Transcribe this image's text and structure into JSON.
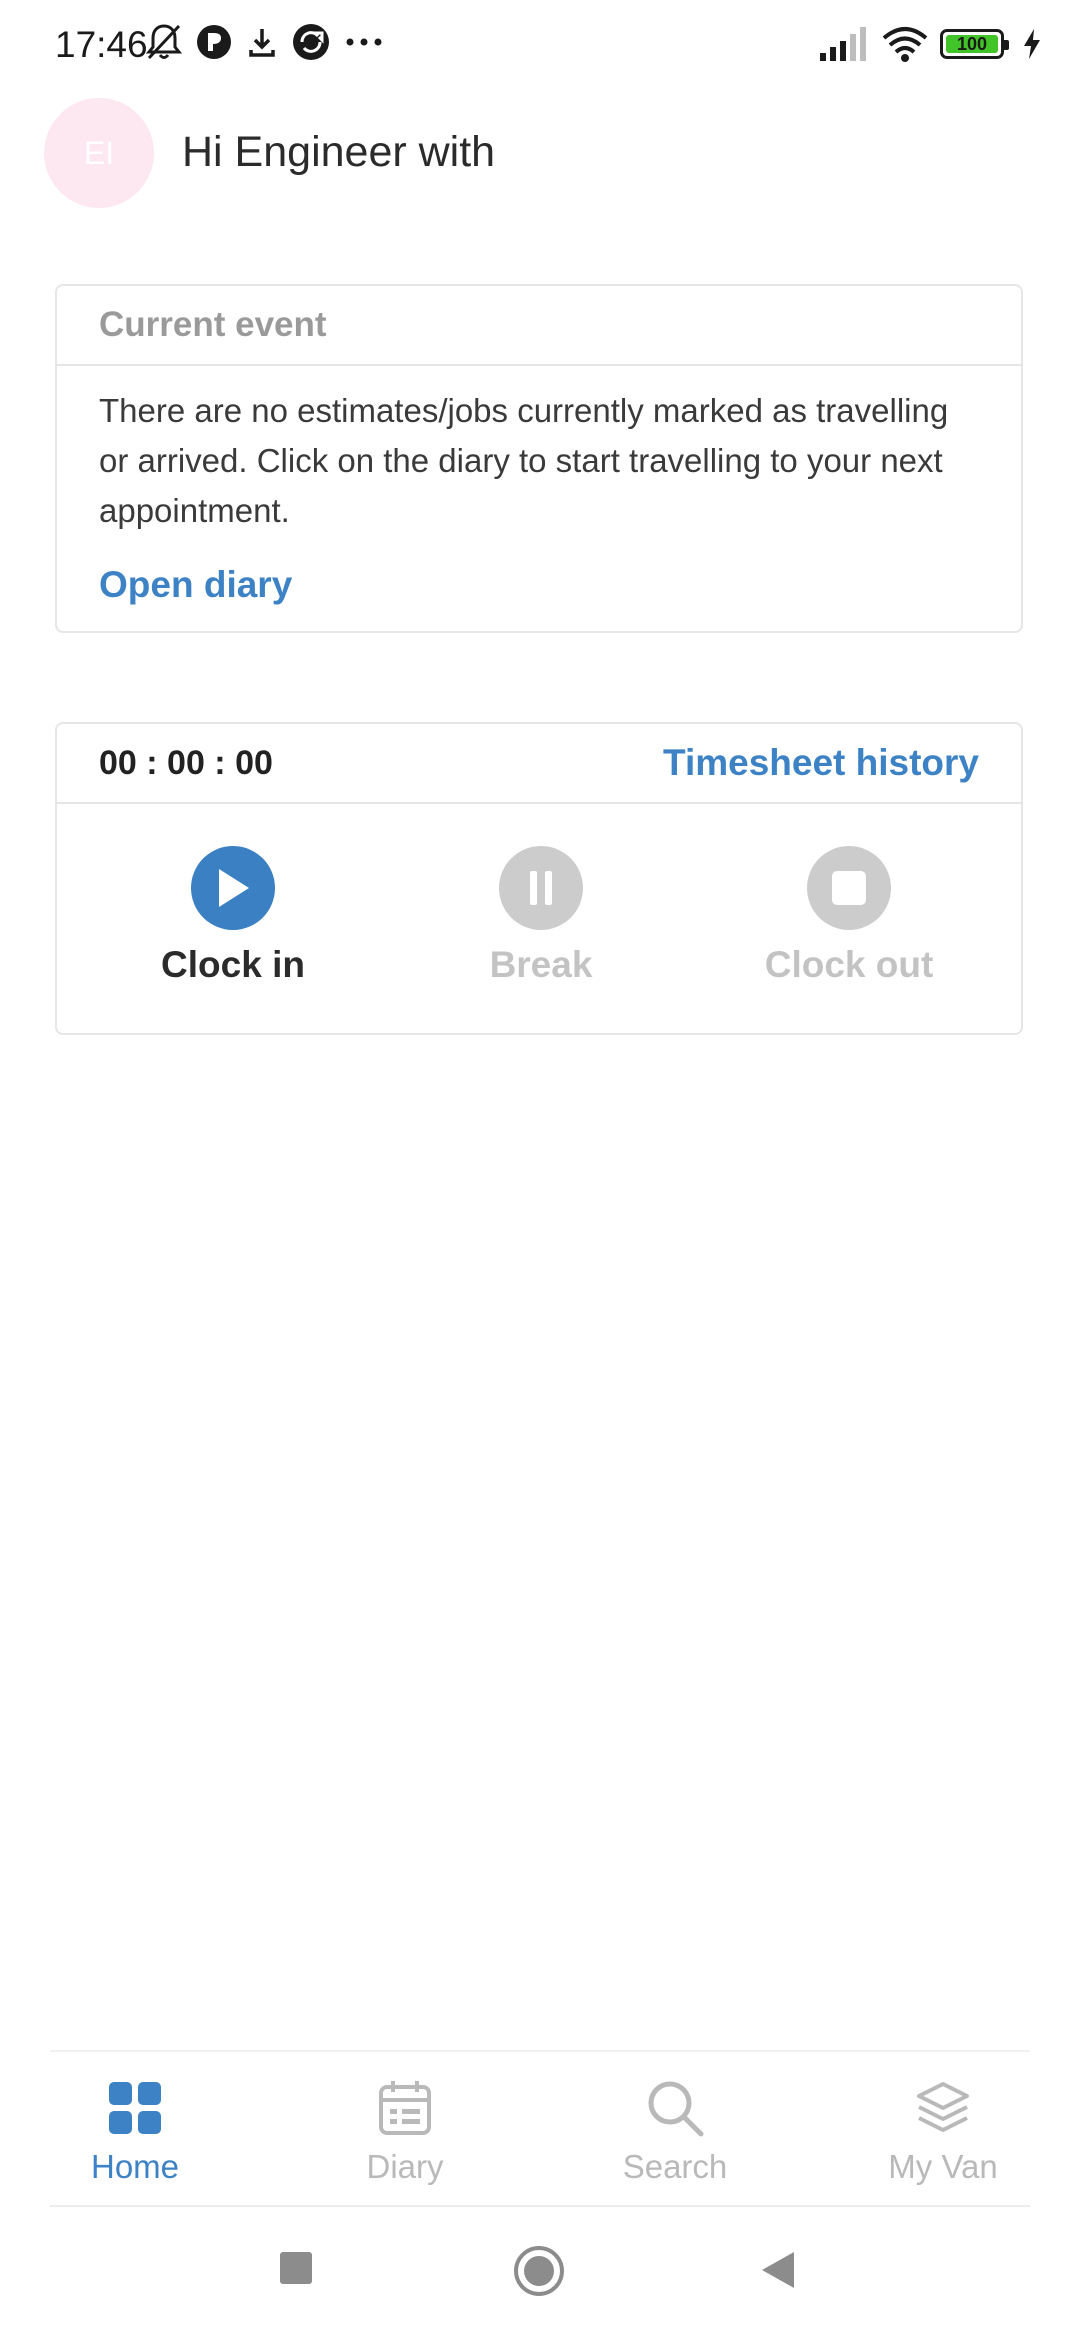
{
  "status_bar": {
    "time": "17:46",
    "battery_level": "100",
    "icons": [
      "bell-muted-icon",
      "app-icon",
      "download-icon",
      "sync-icon",
      "more-icon",
      "signal-icon",
      "wifi-icon",
      "battery-icon",
      "charging-icon"
    ]
  },
  "header": {
    "avatar_initials": "EI",
    "greeting": "Hi Engineer with"
  },
  "current_event": {
    "title": "Current event",
    "message": "There are no estimates/jobs currently marked as travelling or arrived. Click on the diary to start travelling to your next appointment.",
    "open_diary_label": "Open diary"
  },
  "timesheet": {
    "timer": "00 : 00 : 00",
    "history_label": "Timesheet history",
    "actions": [
      {
        "label": "Clock in",
        "enabled": true,
        "icon": "play-icon"
      },
      {
        "label": "Break",
        "enabled": false,
        "icon": "pause-icon"
      },
      {
        "label": "Clock out",
        "enabled": false,
        "icon": "stop-icon"
      }
    ]
  },
  "bottom_nav": {
    "items": [
      {
        "label": "Home",
        "icon": "grid-icon",
        "active": true
      },
      {
        "label": "Diary",
        "icon": "calendar-icon",
        "active": false
      },
      {
        "label": "Search",
        "icon": "search-icon",
        "active": false
      },
      {
        "label": "My Van",
        "icon": "layers-icon",
        "active": false
      }
    ]
  },
  "colors": {
    "accent": "#3c82c4",
    "disabled": "#cccccc",
    "avatar_bg": "#fde7f1",
    "battery": "#41c427"
  }
}
